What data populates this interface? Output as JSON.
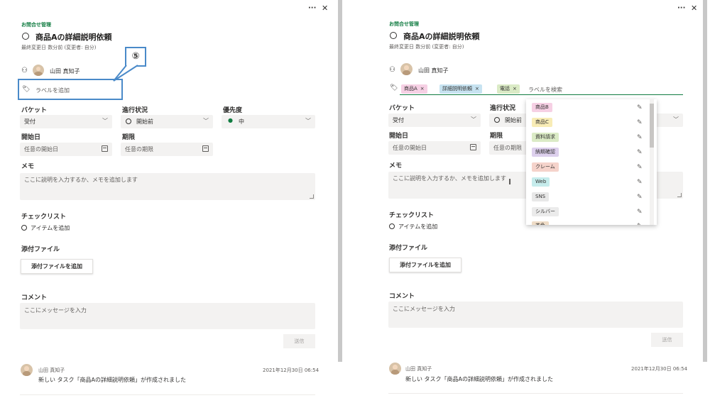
{
  "header": {
    "more_icon": "···",
    "close_icon": "✕"
  },
  "task": {
    "category": "お問合せ管理",
    "title": "商品Aの詳細説明依頼",
    "last_modified": "最終変更日 数分前 (変更者: 自分)"
  },
  "assignee": {
    "name": "山田 真知子"
  },
  "labels": {
    "add_label": "ラベルを追加",
    "search_placeholder": "ラベルを検索",
    "applied": [
      {
        "name": "商品A",
        "color": "#f6d0e4"
      },
      {
        "name": "詳細説明依頼",
        "color": "#c7e3f1"
      },
      {
        "name": "電話",
        "color": "#dbebc6"
      }
    ],
    "remove_icon": "×"
  },
  "callout": {
    "step": "⑤",
    "color": "#4a8ac9"
  },
  "fields": {
    "bucket_label": "バケット",
    "bucket_value": "受付",
    "progress_label": "進行状況",
    "progress_value": "開始前",
    "priority_label": "優先度",
    "priority_value": "中",
    "start_label": "開始日",
    "start_placeholder": "任意の開始日",
    "due_label": "期限",
    "due_placeholder": "任意の期限"
  },
  "memo": {
    "label": "メモ",
    "placeholder": "ここに説明を入力するか、メモを追加します"
  },
  "checklist": {
    "label": "チェックリスト",
    "add_item": "アイテムを追加"
  },
  "attachments": {
    "label": "添付ファイル",
    "add_button": "添付ファイルを追加"
  },
  "comments": {
    "label": "コメント",
    "placeholder": "ここにメッセージを入力",
    "send": "送信",
    "entries": [
      {
        "author": "山田 真知子",
        "timestamp": "2021年12月30日 06:54",
        "text": "新しい タスク「商品Aの詳細説明依頼」が作成されました"
      }
    ]
  },
  "label_dropdown": {
    "items": [
      {
        "name": "商品B",
        "color": "#f6d0e4"
      },
      {
        "name": "商品C",
        "color": "#f8ecb6"
      },
      {
        "name": "資料請求",
        "color": "#dbebc6"
      },
      {
        "name": "納期確認",
        "color": "#ddd0ed"
      },
      {
        "name": "クレーム",
        "color": "#f5d3cb"
      },
      {
        "name": "Web",
        "color": "#c6ecec"
      },
      {
        "name": "SNS",
        "color": "#e8e8e8"
      },
      {
        "name": "シルバー",
        "color": "#ebebeb"
      },
      {
        "name": "茶色",
        "color": "#efdcc6"
      }
    ],
    "edit_icon": "✎"
  },
  "colors": {
    "accent_green": "#107c41",
    "callout_blue": "#4a8ac9",
    "field_bg": "#f3f2f1"
  }
}
